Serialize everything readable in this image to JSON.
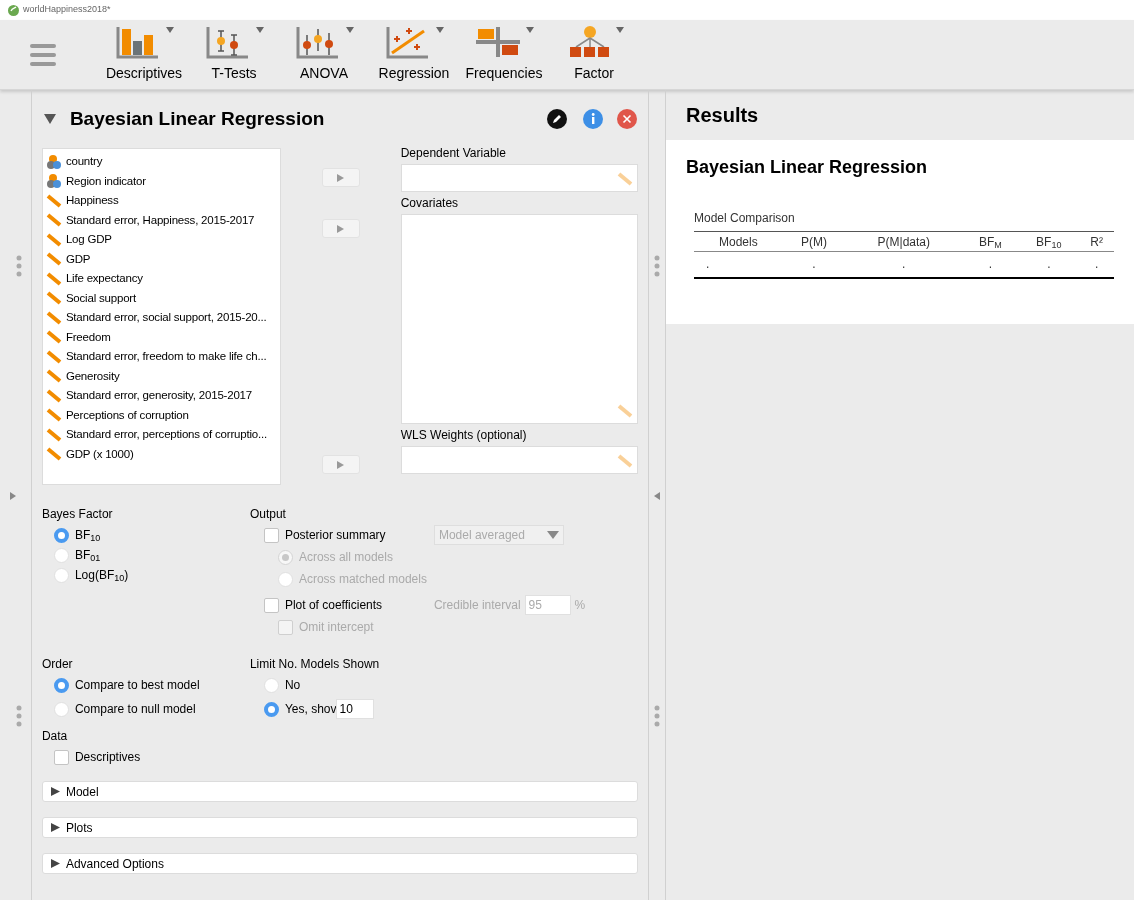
{
  "window": {
    "title": "worldHappiness2018*"
  },
  "toolbar": {
    "items": [
      {
        "label": "Descriptives",
        "kind": "descriptives"
      },
      {
        "label": "T-Tests",
        "kind": "ttests"
      },
      {
        "label": "ANOVA",
        "kind": "anova"
      },
      {
        "label": "Regression",
        "kind": "regression"
      },
      {
        "label": "Frequencies",
        "kind": "frequencies"
      },
      {
        "label": "Factor",
        "kind": "factor"
      }
    ]
  },
  "analysis": {
    "title": "Bayesian Linear Regression",
    "expanded": true,
    "variables": [
      {
        "name": "country",
        "kind": "nominal"
      },
      {
        "name": "Region indicator",
        "kind": "nominal"
      },
      {
        "name": "Happiness",
        "kind": "scale"
      },
      {
        "name": "Standard error, Happiness, 2015-2017",
        "kind": "scale"
      },
      {
        "name": "Log GDP",
        "kind": "scale"
      },
      {
        "name": "GDP",
        "kind": "scale"
      },
      {
        "name": "Life expectancy",
        "kind": "scale"
      },
      {
        "name": "Social support",
        "kind": "scale"
      },
      {
        "name": "Standard error, social support, 2015-20...",
        "kind": "scale"
      },
      {
        "name": "Freedom",
        "kind": "scale"
      },
      {
        "name": "Standard error, freedom to make life ch...",
        "kind": "scale"
      },
      {
        "name": "Generosity",
        "kind": "scale"
      },
      {
        "name": "Standard error, generosity, 2015-2017",
        "kind": "scale"
      },
      {
        "name": "Perceptions of corruption",
        "kind": "scale"
      },
      {
        "name": "Standard error, perceptions of corruptio...",
        "kind": "scale"
      },
      {
        "name": "GDP (x 1000)",
        "kind": "scale"
      }
    ],
    "targets": [
      {
        "label": "Dependent Variable",
        "kind": "single"
      },
      {
        "label": "Covariates",
        "kind": "multi"
      },
      {
        "label": "WLS Weights (optional)",
        "kind": "single"
      }
    ],
    "bayes_factor": {
      "label": "Bayes Factor",
      "options": [
        {
          "label": "BF$_{10}$",
          "selected": true
        },
        {
          "label": "BF$_{01}$",
          "selected": false
        },
        {
          "label": "Log(BF$_{10}$)",
          "selected": false
        }
      ]
    },
    "output": {
      "label": "Output",
      "items": [
        {
          "kind": "checkbox",
          "label": "Posterior summary",
          "checked": false,
          "disabled": false,
          "dropdown": "Model averaged",
          "children": [
            {
              "kind": "radio",
              "label": "Across all models",
              "selected": true,
              "disabled": true
            },
            {
              "kind": "radio",
              "label": "Across matched models",
              "selected": false,
              "disabled": true
            }
          ]
        },
        {
          "kind": "checkbox",
          "label": "Plot of coefficients",
          "checked": false,
          "disabled": false,
          "field_label": "Credible interval",
          "field_value": "95",
          "field_unit": "%",
          "children": [
            {
              "kind": "checkbox",
              "label": "Omit intercept",
              "checked": false,
              "disabled": true
            }
          ]
        }
      ]
    },
    "order": {
      "label": "Order",
      "options": [
        {
          "label": "Compare to best model",
          "selected": true
        },
        {
          "label": "Compare to null model",
          "selected": false
        }
      ]
    },
    "limit": {
      "label": "Limit No. Models Shown",
      "options": [
        {
          "label": "No",
          "selected": false
        },
        {
          "label": "Yes, shov",
          "selected": true,
          "value": "10"
        }
      ]
    },
    "data": {
      "label": "Data",
      "items": [
        {
          "label": "Descriptives",
          "checked": false
        }
      ]
    },
    "sections": [
      {
        "label": "Model",
        "expanded": false
      },
      {
        "label": "Plots",
        "expanded": false
      },
      {
        "label": "Advanced Options",
        "expanded": false
      }
    ]
  },
  "results": {
    "title": "Results",
    "section_title": "Bayesian Linear Regression",
    "table": {
      "title": "Model Comparison",
      "columns": [
        "Models",
        "P(M)",
        "P(M|data)",
        "BF$_{M}$",
        "BF$_{10}$",
        "R²"
      ],
      "rows": [
        [
          ".",
          ".",
          ".",
          ".",
          ".",
          "."
        ]
      ]
    }
  }
}
